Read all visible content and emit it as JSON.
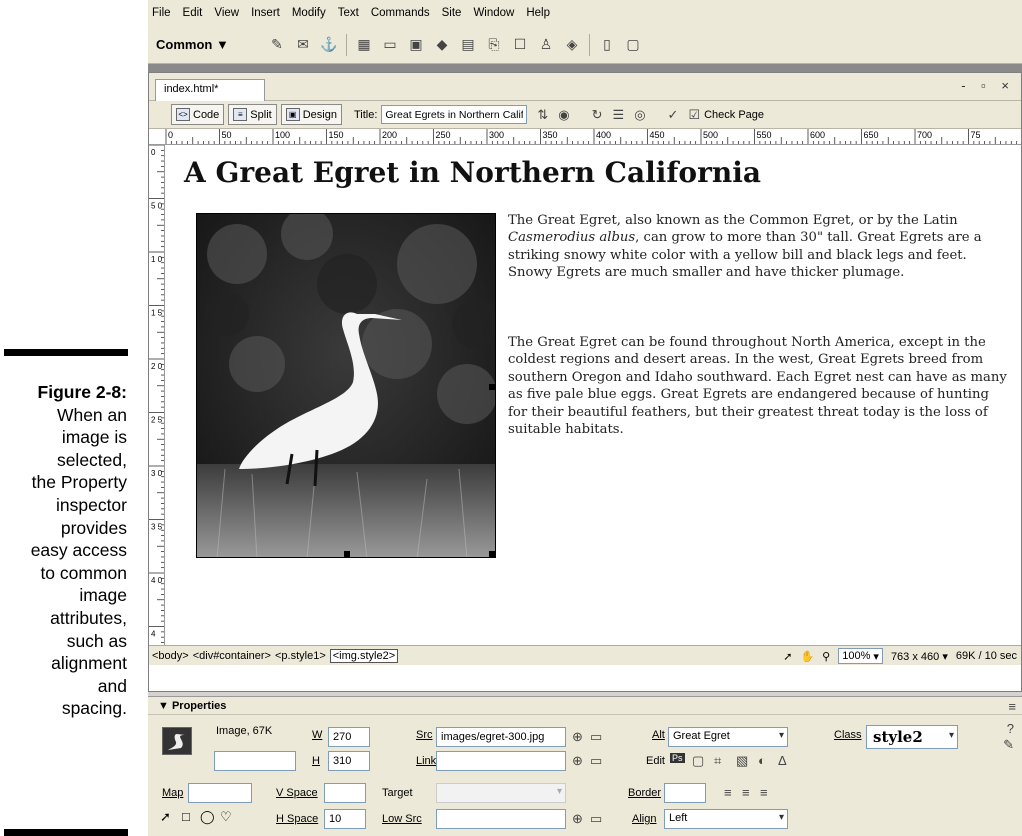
{
  "caption": {
    "figure": "Figure 2-8:",
    "lines": [
      "When an",
      "image is",
      "selected,",
      "the Property",
      "inspector",
      "provides",
      "easy access",
      "to common",
      "image",
      "attributes,",
      "such as",
      "alignment",
      "and",
      "spacing."
    ]
  },
  "menu": [
    "File",
    "Edit",
    "View",
    "Insert",
    "Modify",
    "Text",
    "Commands",
    "Site",
    "Window",
    "Help"
  ],
  "insert_bar": {
    "category": "Common ▼"
  },
  "document": {
    "tab": "index.html*",
    "window_controls": "- ▫ ×",
    "views": {
      "code": "Code",
      "split": "Split",
      "design": "Design"
    },
    "title_label": "Title:",
    "title_value": "Great Egrets in Northern Califo",
    "check_page": "Check Page"
  },
  "ruler_labels": [
    "0",
    "50",
    "100",
    "150",
    "200",
    "250",
    "300",
    "350",
    "400",
    "450",
    "500",
    "550",
    "600",
    "650",
    "700",
    "75"
  ],
  "vruler_labels": [
    "0",
    "5 0",
    "1 0 0",
    "1 5 0",
    "2 0 0",
    "2 5 0",
    "3 0 0",
    "3 5 0",
    "4 0 0",
    "4"
  ],
  "content": {
    "heading": "A Great Egret in Northern California",
    "para1_pre": "The Great Egret, also known as the Common Egret, or by the Latin ",
    "para1_italic": "Casmerodius albus",
    "para1_post": ", can grow to more than 30\" tall. Great Egrets are a striking snowy white color with a yellow bill and black legs and feet. Snowy Egrets are much smaller and have thicker plumage.",
    "para2": "The Great Egret can be found throughout North America, except in the coldest regions and desert areas. In the west, Great Egrets breed from southern Oregon and Idaho southward. Each Egret nest can have as many as five pale blue eggs. Great Egrets are endangered because of hunting for their beautiful feathers, but their greatest threat today is the loss of suitable habitats."
  },
  "status": {
    "tags": [
      "<body>",
      "<div#container>",
      "<p.style1>",
      "<img.style2>"
    ],
    "zoom": "100%",
    "size": "763 x 460",
    "download": "69K / 10 sec"
  },
  "properties": {
    "header": "Properties",
    "image_info": "Image, 67K",
    "name_value": "",
    "w_label": "W",
    "w_value": "270",
    "h_label": "H",
    "h_value": "310",
    "src_label": "Src",
    "src_value": "images/egret-300.jpg",
    "link_label": "Link",
    "link_value": "",
    "alt_label": "Alt",
    "alt_value": "Great Egret",
    "edit_label": "Edit",
    "class_label": "Class",
    "class_value": "style2",
    "map_label": "Map",
    "map_value": "",
    "vspace_label": "V Space",
    "vspace_value": "",
    "target_label": "Target",
    "target_value": "",
    "border_label": "Border",
    "border_value": "",
    "hspace_label": "H Space",
    "hspace_value": "10",
    "lowsrc_label": "Low Src",
    "lowsrc_value": "",
    "align_label": "Align",
    "align_value": "Left"
  }
}
